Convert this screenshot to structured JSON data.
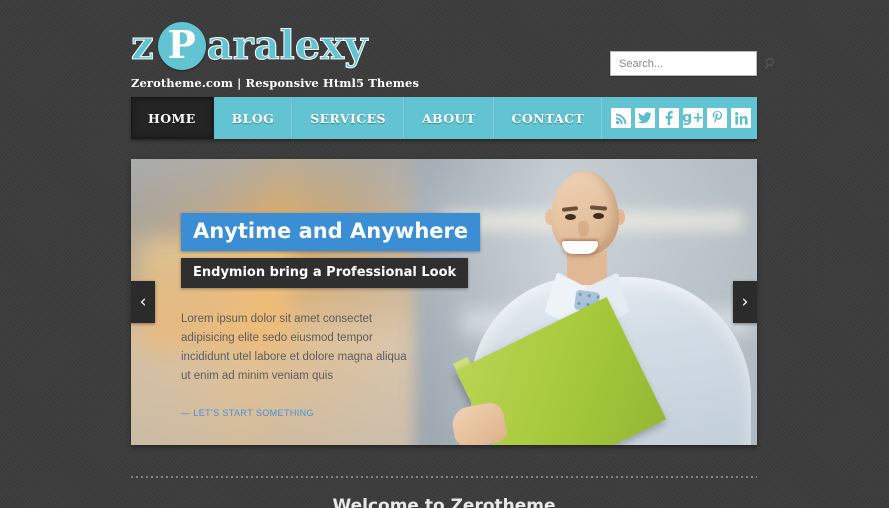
{
  "site": {
    "background_color": "#3c3c3c",
    "accent_color": "#62c4d3",
    "highlight_color": "#3b8ed4"
  },
  "logo": {
    "letter_z": "z",
    "letter_p": "P",
    "rest": "aralexy",
    "tagline": "Zerotheme.com | Responsive Html5 Themes"
  },
  "search": {
    "placeholder": "Search...",
    "value": "",
    "icon": "search-icon"
  },
  "nav": {
    "items": [
      {
        "label": "HOME",
        "active": true
      },
      {
        "label": "BLOG",
        "active": false
      },
      {
        "label": "SERVICES",
        "active": false
      },
      {
        "label": "ABOUT",
        "active": false
      },
      {
        "label": "CONTACT",
        "active": false
      }
    ]
  },
  "social": {
    "items": [
      {
        "name": "rss-icon",
        "glyph": ""
      },
      {
        "name": "twitter-icon",
        "glyph": ""
      },
      {
        "name": "facebook-icon",
        "glyph": "f"
      },
      {
        "name": "google-plus-icon",
        "glyph": "g+"
      },
      {
        "name": "pinterest-icon",
        "glyph": "P"
      },
      {
        "name": "linkedin-icon",
        "glyph": "in"
      }
    ]
  },
  "slider": {
    "title": "Anytime and Anywhere",
    "subtitle": "Endymion bring a Professional Look",
    "description": "Lorem ipsum dolor sit amet consectet adipisicing elite sedo eiusmod tempor incididunt utel labore et dolore magna aliqua ut enim ad minim veniam quis",
    "link_label": "— LET'S START SOMETHING",
    "prev_label": "‹",
    "next_label": "›",
    "image_alt": "Smiling businessman holding a green folder in a blurred office"
  },
  "below": {
    "heading": "Welcome to Zerotheme"
  }
}
